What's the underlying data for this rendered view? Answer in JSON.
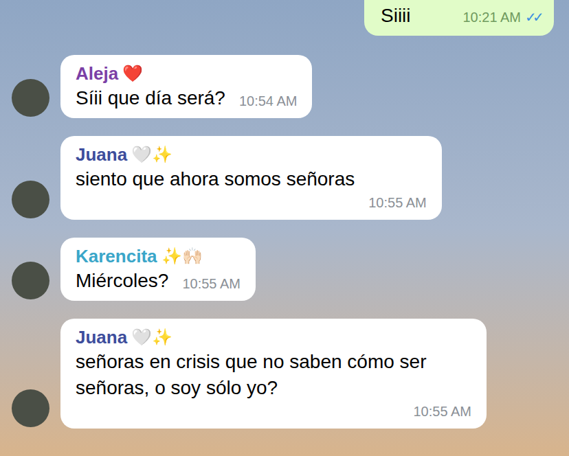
{
  "outgoing": {
    "text": "Siiii",
    "time": "10:21 AM",
    "read": true,
    "checks": "✓✓"
  },
  "messages": [
    {
      "sender": "Aleja",
      "emoji": "❤️",
      "color": "#7b3fa6",
      "text": "Síii que día será?",
      "time": "10:54 AM"
    },
    {
      "sender": "Juana",
      "emoji": "🤍✨",
      "color": "#3d4d9c",
      "text": "siento que ahora somos señoras",
      "time": "10:55 AM"
    },
    {
      "sender": "Karencita",
      "emoji": "✨🙌🏻",
      "color": "#3aa6c9",
      "text": "Miércoles?",
      "time": "10:55 AM"
    },
    {
      "sender": "Juana",
      "emoji": "🤍✨",
      "color": "#3d4d9c",
      "text": "señoras en crisis que no saben cómo ser señoras, o soy sólo yo?",
      "time": "10:55 AM"
    }
  ]
}
